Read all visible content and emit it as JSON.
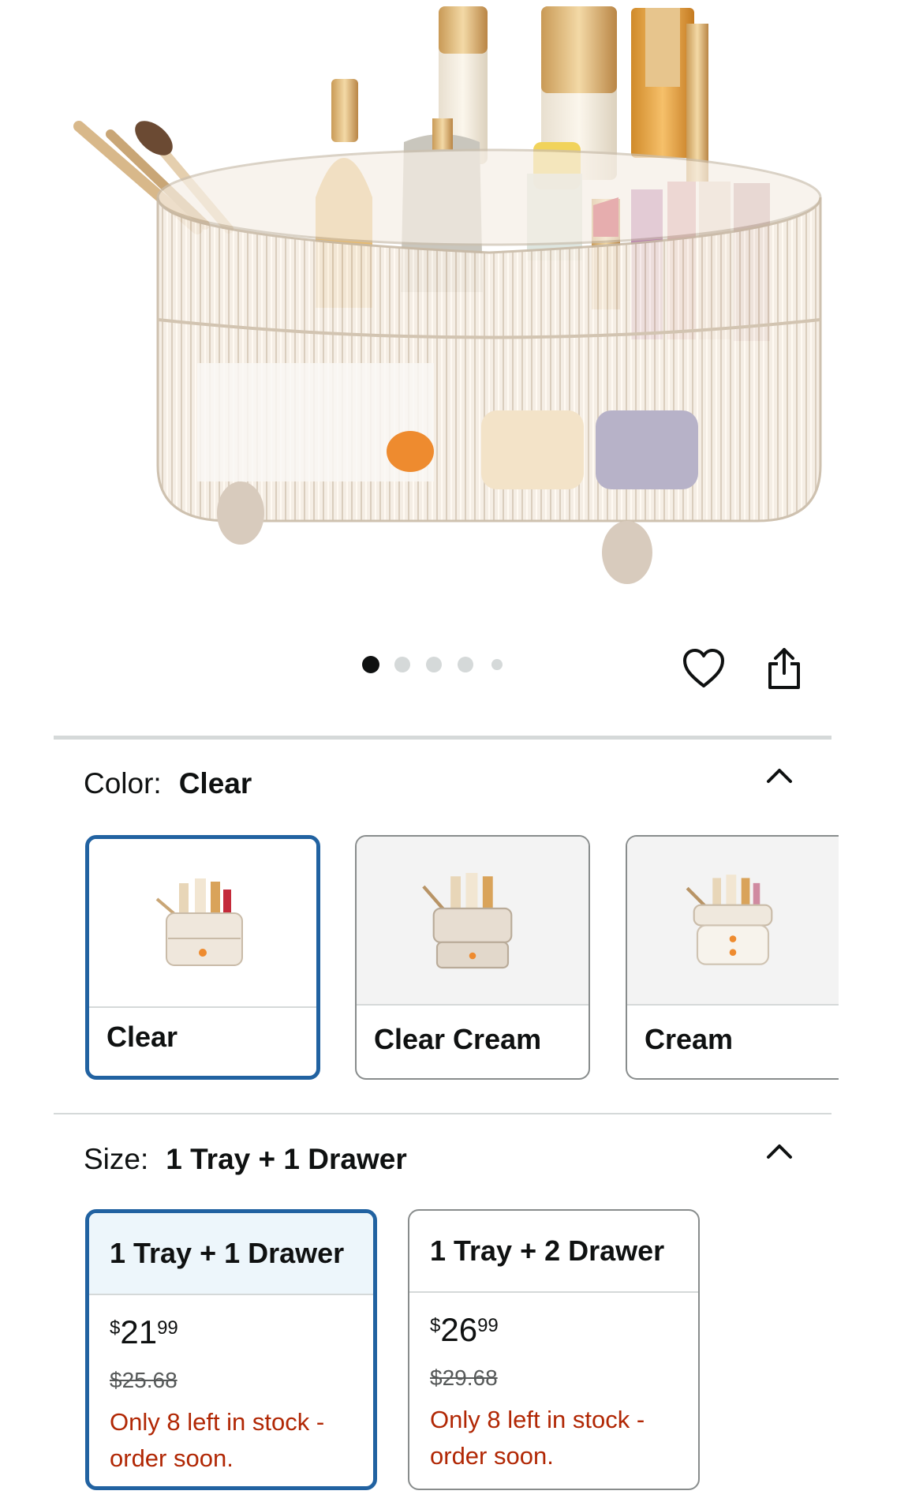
{
  "carousel": {
    "dot_count": 5,
    "active_index": 0
  },
  "actions": {
    "wishlist_icon": "heart-outline-icon",
    "share_icon": "share-icon"
  },
  "color": {
    "label": "Color:",
    "selected": "Clear",
    "options": [
      {
        "name": "Clear",
        "selected": true
      },
      {
        "name": "Clear Cream",
        "selected": false
      },
      {
        "name": "Cream",
        "selected": false
      }
    ]
  },
  "size": {
    "label": "Size:",
    "selected": "1 Tray + 1 Drawer",
    "options": [
      {
        "name": "1 Tray + 1 Drawer",
        "price_symbol": "$",
        "price_whole": "21",
        "price_fraction": "99",
        "list_price": "$25.68",
        "stock_note": "Only 8 left in stock - order soon.",
        "selected": true
      },
      {
        "name": "1 Tray + 2 Drawer",
        "price_symbol": "$",
        "price_whole": "26",
        "price_fraction": "99",
        "list_price": "$29.68",
        "stock_note": "Only 8 left in stock - order soon.",
        "selected": false
      }
    ]
  },
  "colors": {
    "accent": "#2162a1",
    "deal_red": "#b12704",
    "muted": "#565959",
    "selected_bg": "#edf6fb"
  }
}
